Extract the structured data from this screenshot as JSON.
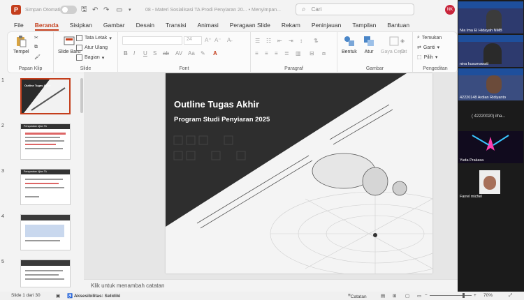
{
  "titlebar": {
    "autosave_label": "Simpan Otomatis",
    "doc_title": "08 - Materi Sosialisasi TA Prodi Penyiaran 20... • Menyimpan...",
    "search_placeholder": "Cari",
    "user_initials": "NK"
  },
  "tabs": [
    "File",
    "Beranda",
    "Sisipkan",
    "Gambar",
    "Desain",
    "Transisi",
    "Animasi",
    "Peragaan Slide",
    "Rekam",
    "Peninjauan",
    "Tampilan",
    "Bantuan"
  ],
  "active_tab": "Beranda",
  "ribbon": {
    "clipboard": {
      "paste": "Tempel",
      "label": "Papan Klip"
    },
    "slides": {
      "new_slide": "Slide Baru",
      "layout": "Tata Letak",
      "reset": "Atur Ulang",
      "section": "Bagian",
      "label": "Slide"
    },
    "font": {
      "label": "Font",
      "size": "24"
    },
    "paragraph": {
      "label": "Paragraf"
    },
    "drawing": {
      "shapes": "Bentuk",
      "arrange": "Atur",
      "styles": "Gaya Cepat",
      "label": "Gambar"
    },
    "editing": {
      "find": "Temukan",
      "replace": "Ganti",
      "select": "Pilih",
      "label": "Pengeditan"
    }
  },
  "thumbnails": [
    {
      "num": "1",
      "title": "Outline Tugas Akhir",
      "selected": true
    },
    {
      "num": "2",
      "title": "Persyaratan Ujian TA"
    },
    {
      "num": "3",
      "title": "Persyaratan Ujian TA"
    },
    {
      "num": "4",
      "title": ""
    },
    {
      "num": "5",
      "title": ""
    }
  ],
  "slide": {
    "title": "Outline Tugas Akhir",
    "subtitle": "Program Studi Penyiaran 2025"
  },
  "notes_placeholder": "Klik untuk menambah catatan",
  "status": {
    "slide_count": "Slide 1 dari 30",
    "accessibility": "Aksesibilitas: Selidiki",
    "notes_btn": "Catatan",
    "zoom": "70%"
  },
  "participants": [
    {
      "name": "Nia Ima El Hidayah NMB"
    },
    {
      "name": "nina kusumawati"
    },
    {
      "name": "42220148 Ardian Ridiyanto"
    },
    {
      "name": "( 42220020) ilha..."
    },
    {
      "name": "Yuda Prakasa"
    },
    {
      "name": "Farrel michel"
    }
  ],
  "colors": {
    "accent": "#c43e1c",
    "panel": "#1b1b1b"
  }
}
